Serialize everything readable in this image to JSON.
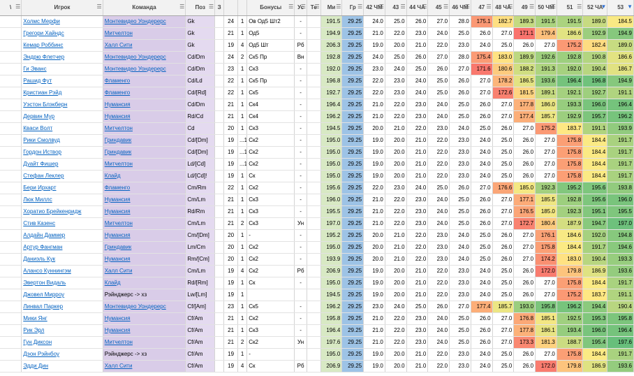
{
  "columns": [
    {
      "label": "\\",
      "filter": true
    },
    {
      "label": "Игрок",
      "filter": true
    },
    {
      "label": "Команда",
      "filter": true
    },
    {
      "label": "Поз",
      "filter": true
    },
    {
      "label": "З",
      "filter": false
    },
    {
      "label": "",
      "filter": false
    },
    {
      "label": "",
      "filter": false
    },
    {
      "label": "Бонусы",
      "filter": true
    },
    {
      "label": "Ус",
      "filter": true
    },
    {
      "label": "Те",
      "filter": true
    },
    {
      "label": "Ми",
      "filter": true
    },
    {
      "label": "Гр",
      "filter": true
    },
    {
      "label": "42 ЧМ",
      "filter": true
    },
    {
      "label": "43",
      "filter": true
    },
    {
      "label": "44 ЧА",
      "filter": true
    },
    {
      "label": "45",
      "filter": true
    },
    {
      "label": "46 ЧМ",
      "filter": true
    },
    {
      "label": "47",
      "filter": true
    },
    {
      "label": "48 ЧА",
      "filter": true
    },
    {
      "label": "49",
      "filter": true
    },
    {
      "label": "50 ЧМ",
      "filter": true
    },
    {
      "label": "51",
      "filter": true
    },
    {
      "label": "52 ЧА",
      "filter": true,
      "active": true
    },
    {
      "label": "53",
      "filter": true,
      "active": true
    }
  ],
  "rows": [
    {
      "player": "Холмс Мерфи",
      "team": "Монтевидео Уондерерс",
      "team_link": true,
      "pos": "Gk",
      "age": "24",
      "n": "1",
      "bonus": "Ов Од5 Шт2",
      "us": "-",
      "te": "",
      "mi": "191.5",
      "gr": "29.25",
      "v42": "24.0",
      "v43": "25.0",
      "v44": "26.0",
      "v45": "27.0",
      "v46": "28.0",
      "v47": "175.1",
      "v48": "182.7",
      "v49": "189.3",
      "v50": "191.5",
      "v51": "191.5",
      "v52": "189.0",
      "v53": "184.5",
      "grp": false
    },
    {
      "player": "Грегори Хайндс",
      "team": "Митчелтон",
      "team_link": true,
      "pos": "Gk",
      "age": "21",
      "n": "1",
      "bonus": "Од5",
      "us": "-",
      "te": "",
      "mi": "194.9",
      "gr": "29.25",
      "v42": "21.0",
      "v43": "22.0",
      "v44": "23.0",
      "v45": "24.0",
      "v46": "25.0",
      "v47": "26.0",
      "v48": "27.0",
      "v49": "171.1",
      "v50": "179.4",
      "v51": "186.6",
      "v52": "192.9",
      "v53": "194.9",
      "grp": false
    },
    {
      "player": "Кемар Роббинс",
      "team": "Халл Сити",
      "team_link": true,
      "pos": "Gk",
      "age": "19",
      "n": "4",
      "bonus": "Од5 Шт",
      "us": "Рб",
      "te": "",
      "mi": "206.3",
      "gr": "29.25",
      "v42": "19.0",
      "v43": "20.0",
      "v44": "21.0",
      "v45": "22.0",
      "v46": "23.0",
      "v47": "24.0",
      "v48": "25.0",
      "v49": "26.0",
      "v50": "27.0",
      "v51": "175.2",
      "v52": "182.4",
      "v53": "189.0",
      "grp": false
    },
    {
      "player": "Эндрю Флетчер",
      "team": "Монтевидео Уондерерс",
      "team_link": true,
      "pos": "Cd/Dm",
      "age": "24",
      "n": "2",
      "bonus": "Ск5 Пр",
      "us": "Вн",
      "te": "",
      "mi": "192.8",
      "gr": "29.25",
      "v42": "24.0",
      "v43": "25.0",
      "v44": "26.0",
      "v45": "27.0",
      "v46": "28.0",
      "v47": "175.4",
      "v48": "183.0",
      "v49": "189.9",
      "v50": "192.6",
      "v51": "192.8",
      "v52": "190.8",
      "v53": "186.6",
      "grp": false
    },
    {
      "player": "Ги Эванс",
      "team": "Монтевидео Уондерерс",
      "team_link": true,
      "pos": "Cd/Dm",
      "age": "23",
      "n": "1",
      "bonus": "Ск3",
      "us": "-",
      "te": "",
      "mi": "192.0",
      "gr": "29.25",
      "v42": "23.0",
      "v43": "24.0",
      "v44": "25.0",
      "v45": "26.0",
      "v46": "27.0",
      "v47": "171.6",
      "v48": "180.6",
      "v49": "188.2",
      "v50": "191.3",
      "v51": "192.0",
      "v52": "190.4",
      "v53": "186.7",
      "grp": false
    },
    {
      "player": "Рашид Фут",
      "team": "Фламенго",
      "team_link": true,
      "pos": "Cd/Ld",
      "age": "22",
      "n": "1",
      "bonus": "Ск5 Пр",
      "us": "-",
      "te": "",
      "mi": "196.8",
      "gr": "29.25",
      "v42": "22.0",
      "v43": "23.0",
      "v44": "24.0",
      "v45": "25.0",
      "v46": "26.0",
      "v47": "27.0",
      "v48": "178.2",
      "v49": "186.5",
      "v50": "193.6",
      "v51": "196.4",
      "v52": "196.8",
      "v53": "194.9",
      "grp": false
    },
    {
      "player": "Кристиан Рэйд",
      "team": "Фламенго",
      "team_link": true,
      "pos": "Cd/[Rd]",
      "age": "22",
      "n": "1",
      "bonus": "Ск5",
      "us": "-",
      "te": "",
      "mi": "192.7",
      "gr": "29.25",
      "v42": "22.0",
      "v43": "23.0",
      "v44": "24.0",
      "v45": "25.0",
      "v46": "26.0",
      "v47": "27.0",
      "v48": "172.6",
      "v49": "181.5",
      "v50": "189.1",
      "v51": "192.1",
      "v52": "192.7",
      "v53": "191.1",
      "grp": true
    },
    {
      "player": "Уэстон Блэкберн",
      "team": "Нумансия",
      "team_link": true,
      "pos": "Cd/Dm",
      "age": "21",
      "n": "1",
      "bonus": "Ск4",
      "us": "-",
      "te": "",
      "mi": "196.4",
      "gr": "29.25",
      "v42": "21.0",
      "v43": "22.0",
      "v44": "23.0",
      "v45": "24.0",
      "v46": "25.0",
      "v47": "26.0",
      "v48": "27.0",
      "v49": "177.8",
      "v50": "186.0",
      "v51": "193.3",
      "v52": "196.0",
      "v53": "196.4",
      "grp": true
    },
    {
      "player": "Дервин Мур",
      "team": "Нумансия",
      "team_link": true,
      "pos": "Rd/Cd",
      "age": "21",
      "n": "1",
      "bonus": "Ск4",
      "us": "-",
      "te": "",
      "mi": "196.2",
      "gr": "29.25",
      "v42": "21.0",
      "v43": "22.0",
      "v44": "23.0",
      "v45": "24.0",
      "v46": "25.0",
      "v47": "26.0",
      "v48": "27.0",
      "v49": "177.4",
      "v50": "185.7",
      "v51": "192.9",
      "v52": "195.7",
      "v53": "196.2",
      "grp": false
    },
    {
      "player": "Кваси Волт",
      "team": "Митчелтон",
      "team_link": true,
      "pos": "Cd",
      "age": "20",
      "n": "1",
      "bonus": "Ск3",
      "us": "-",
      "te": "",
      "mi": "194.5",
      "gr": "29.25",
      "v42": "20.0",
      "v43": "21.0",
      "v44": "22.0",
      "v45": "23.0",
      "v46": "24.0",
      "v47": "25.0",
      "v48": "26.0",
      "v49": "27.0",
      "v50": "175.2",
      "v51": "183.7",
      "v52": "191.1",
      "v53": "193.9",
      "grp": false
    },
    {
      "player": "Рики Смолвуд",
      "team": "Гриндавик",
      "team_link": true,
      "pos": "Cd/[Dm]",
      "age": "19",
      "n": "...1",
      "bonus": "Ск2",
      "us": "-",
      "te": "",
      "mi": "195.0",
      "gr": "29.25",
      "v42": "19.0",
      "v43": "20.0",
      "v44": "21.0",
      "v45": "22.0",
      "v46": "23.0",
      "v47": "24.0",
      "v48": "25.0",
      "v49": "26.0",
      "v50": "27.0",
      "v51": "175.8",
      "v52": "184.4",
      "v53": "191.7",
      "grp": false
    },
    {
      "player": "Гордон Иствор",
      "team": "Гриндавик",
      "team_link": true,
      "pos": "Cd/[Dm]",
      "age": "19",
      "n": "...1",
      "bonus": "Ск2",
      "us": "-",
      "te": "",
      "mi": "195.0",
      "gr": "29.25",
      "v42": "19.0",
      "v43": "20.0",
      "v44": "21.0",
      "v45": "22.0",
      "v46": "23.0",
      "v47": "24.0",
      "v48": "25.0",
      "v49": "26.0",
      "v50": "27.0",
      "v51": "175.8",
      "v52": "184.4",
      "v53": "191.7",
      "grp": false
    },
    {
      "player": "Дуайт Фишер",
      "team": "Митчелтон",
      "team_link": true,
      "pos": "Ld/[Cd]",
      "age": "19",
      "n": "...1",
      "bonus": "Ск2",
      "us": "-",
      "te": "",
      "mi": "195.0",
      "gr": "29.25",
      "v42": "19.0",
      "v43": "20.0",
      "v44": "21.0",
      "v45": "22.0",
      "v46": "23.0",
      "v47": "24.0",
      "v48": "25.0",
      "v49": "26.0",
      "v50": "27.0",
      "v51": "175.8",
      "v52": "184.4",
      "v53": "191.7",
      "grp": false
    },
    {
      "player": "Стефан Леклер",
      "team": "Клайд",
      "team_link": true,
      "pos": "Ld/[Cd]!",
      "age": "19",
      "n": "1",
      "bonus": "Ск",
      "us": "-",
      "te": "",
      "mi": "195.0",
      "gr": "29.25",
      "v42": "19.0",
      "v43": "20.0",
      "v44": "21.0",
      "v45": "22.0",
      "v46": "23.0",
      "v47": "24.0",
      "v48": "25.0",
      "v49": "26.0",
      "v50": "27.0",
      "v51": "175.8",
      "v52": "184.4",
      "v53": "191.7",
      "grp": false
    },
    {
      "player": "Бери Ирхарт",
      "team": "Фламенго",
      "team_link": true,
      "pos": "Cm/Rm",
      "age": "22",
      "n": "1",
      "bonus": "Ск2",
      "us": "-",
      "te": "",
      "mi": "195.6",
      "gr": "29.25",
      "v42": "22.0",
      "v43": "23.0",
      "v44": "24.0",
      "v45": "25.0",
      "v46": "26.0",
      "v47": "27.0",
      "v48": "176.6",
      "v49": "185.0",
      "v50": "192.3",
      "v51": "195.2",
      "v52": "195.6",
      "v53": "193.8",
      "grp": true
    },
    {
      "player": "Люк Миллс",
      "team": "Нумансия",
      "team_link": true,
      "pos": "Cm/Lm",
      "age": "21",
      "n": "1",
      "bonus": "Ск3",
      "us": "-",
      "te": "",
      "mi": "196.0",
      "gr": "29.25",
      "v42": "21.0",
      "v43": "22.0",
      "v44": "23.0",
      "v45": "24.0",
      "v46": "25.0",
      "v47": "26.0",
      "v48": "27.0",
      "v49": "177.1",
      "v50": "185.5",
      "v51": "192.8",
      "v52": "195.6",
      "v53": "196.0",
      "grp": false
    },
    {
      "player": "Хоратио Брейкенридж",
      "team": "Нумансия",
      "team_link": true,
      "pos": "Rd/Rm",
      "age": "21",
      "n": "1",
      "bonus": "Ск3",
      "us": "-",
      "te": "",
      "mi": "195.5",
      "gr": "29.25",
      "v42": "21.0",
      "v43": "22.0",
      "v44": "23.0",
      "v45": "24.0",
      "v46": "25.0",
      "v47": "26.0",
      "v48": "27.0",
      "v49": "176.5",
      "v50": "185.0",
      "v51": "192.3",
      "v52": "195.1",
      "v53": "195.5",
      "grp": true
    },
    {
      "player": "Стив Казенс",
      "team": "Митчелтон",
      "team_link": true,
      "pos": "Cm/Lm",
      "age": "21",
      "n": "2",
      "bonus": "Ск3",
      "us": "Ун",
      "te": "",
      "mi": "197.0",
      "gr": "29.25",
      "v42": "21.0",
      "v43": "22.0",
      "v44": "23.0",
      "v45": "24.0",
      "v46": "25.0",
      "v47": "26.0",
      "v48": "27.0",
      "v49": "172.7",
      "v50": "180.4",
      "v51": "187.9",
      "v52": "194.7",
      "v53": "197.0",
      "grp": false
    },
    {
      "player": "Алдайн Даммер",
      "team": "Нумансия",
      "team_link": true,
      "pos": "Cm/[Dm]",
      "age": "20",
      "n": "1",
      "bonus": "-",
      "us": "-",
      "te": "",
      "mi": "195.2",
      "gr": "29.25",
      "v42": "20.0",
      "v43": "21.0",
      "v44": "22.0",
      "v45": "23.0",
      "v46": "24.0",
      "v47": "25.0",
      "v48": "26.0",
      "v49": "27.0",
      "v50": "176.1",
      "v51": "184.6",
      "v52": "192.0",
      "v53": "194.8",
      "grp": false
    },
    {
      "player": "Артур Фангман",
      "team": "Гриндавик",
      "team_link": true,
      "pos": "Lm/Cm",
      "age": "20",
      "n": "1",
      "bonus": "Ск2",
      "us": "-",
      "te": "",
      "mi": "195.0",
      "gr": "29.25",
      "v42": "20.0",
      "v43": "21.0",
      "v44": "22.0",
      "v45": "23.0",
      "v46": "24.0",
      "v47": "25.0",
      "v48": "26.0",
      "v49": "27.0",
      "v50": "175.8",
      "v51": "184.4",
      "v52": "191.7",
      "v53": "194.6",
      "grp": false
    },
    {
      "player": "Даниэль Кук",
      "team": "Нумансия",
      "team_link": true,
      "pos": "Rm/[Cm]",
      "age": "20",
      "n": "1",
      "bonus": "Ск2",
      "us": "-",
      "te": "",
      "mi": "193.9",
      "gr": "29.25",
      "v42": "20.0",
      "v43": "21.0",
      "v44": "22.0",
      "v45": "23.0",
      "v46": "24.0",
      "v47": "25.0",
      "v48": "26.0",
      "v49": "27.0",
      "v50": "174.2",
      "v51": "183.0",
      "v52": "190.4",
      "v53": "193.3",
      "grp": false
    },
    {
      "player": "Алансо Куннингэм",
      "team": "Халл Сити",
      "team_link": true,
      "pos": "Cm/Lm",
      "age": "19",
      "n": "4",
      "bonus": "Ск2",
      "us": "Рб",
      "te": "",
      "mi": "206.9",
      "gr": "29.25",
      "v42": "19.0",
      "v43": "20.0",
      "v44": "21.0",
      "v45": "22.0",
      "v46": "23.0",
      "v47": "24.0",
      "v48": "25.0",
      "v49": "26.0",
      "v50": "172.0",
      "v51": "179.8",
      "v52": "186.9",
      "v53": "193.6",
      "grp": false
    },
    {
      "player": "Эвертон Видаль",
      "team": "Клайд",
      "team_link": true,
      "pos": "Rd/[Rm]",
      "age": "19",
      "n": "1",
      "bonus": "Ск",
      "us": "-",
      "te": "",
      "mi": "195.0",
      "gr": "29.25",
      "v42": "19.0",
      "v43": "20.0",
      "v44": "21.0",
      "v45": "22.0",
      "v46": "23.0",
      "v47": "24.0",
      "v48": "25.0",
      "v49": "26.0",
      "v50": "27.0",
      "v51": "175.8",
      "v52": "184.4",
      "v53": "191.7",
      "grp": false
    },
    {
      "player": "Джовел Мирроу",
      "team": "Рэйнджерс -> хз",
      "team_link": false,
      "pos": "Lw/[Lm]",
      "age": "19",
      "n": "1",
      "bonus": "",
      "us": "",
      "te": "",
      "mi": "194.5",
      "gr": "29.25",
      "v42": "19.0",
      "v43": "20.0",
      "v44": "21.0",
      "v45": "22.0",
      "v46": "23.0",
      "v47": "24.0",
      "v48": "25.0",
      "v49": "26.0",
      "v50": "27.0",
      "v51": "175.2",
      "v52": "183.7",
      "v53": "191.1",
      "grp": false
    },
    {
      "player": "Линвал Паркер",
      "team": "Монтевидео Уондерерс",
      "team_link": true,
      "pos": "Cf/[Am]",
      "age": "23",
      "n": "1",
      "bonus": "Ск5",
      "us": "-",
      "te": "",
      "mi": "196.2",
      "gr": "29.25",
      "v42": "23.0",
      "v43": "24.0",
      "v44": "25.0",
      "v45": "26.0",
      "v46": "27.0",
      "v47": "177.4",
      "v48": "185.7",
      "v49": "193.0",
      "v50": "195.8",
      "v51": "196.2",
      "v52": "194.4",
      "v53": "190.4",
      "grp": true
    },
    {
      "player": "Мики Янг",
      "team": "Нумансия",
      "team_link": true,
      "pos": "Cf/Am",
      "age": "21",
      "n": "1",
      "bonus": "Ск2",
      "us": "-",
      "te": "",
      "mi": "195.8",
      "gr": "29.25",
      "v42": "21.0",
      "v43": "22.0",
      "v44": "23.0",
      "v45": "24.0",
      "v46": "25.0",
      "v47": "26.0",
      "v48": "27.0",
      "v49": "176.8",
      "v50": "185.1",
      "v51": "192.5",
      "v52": "195.3",
      "v53": "195.8",
      "grp": false
    },
    {
      "player": "Рик Эрл",
      "team": "Нумансия",
      "team_link": true,
      "pos": "Cf/Am",
      "age": "21",
      "n": "1",
      "bonus": "Ск3",
      "us": "-",
      "te": "",
      "mi": "196.4",
      "gr": "29.25",
      "v42": "21.0",
      "v43": "22.0",
      "v44": "23.0",
      "v45": "24.0",
      "v46": "25.0",
      "v47": "26.0",
      "v48": "27.0",
      "v49": "177.8",
      "v50": "186.1",
      "v51": "193.4",
      "v52": "196.0",
      "v53": "196.4",
      "grp": false
    },
    {
      "player": "Гун Диксон",
      "team": "Митчелтон",
      "team_link": true,
      "pos": "Cf/Am",
      "age": "21",
      "n": "2",
      "bonus": "Ск2",
      "us": "Ун",
      "te": "",
      "mi": "197.6",
      "gr": "29.25",
      "v42": "21.0",
      "v43": "22.0",
      "v44": "23.0",
      "v45": "24.0",
      "v46": "25.0",
      "v47": "26.0",
      "v48": "27.0",
      "v49": "173.3",
      "v50": "181.3",
      "v51": "188.7",
      "v52": "195.4",
      "v53": "197.6",
      "grp": false
    },
    {
      "player": "Дэон Рэйнбоу",
      "team": "Рэйнджерс -> хз",
      "team_link": false,
      "pos": "Cf/Am",
      "age": "19",
      "n": "1",
      "bonus": "-",
      "us": "",
      "te": "",
      "mi": "195.0",
      "gr": "29.25",
      "v42": "19.0",
      "v43": "20.0",
      "v44": "21.0",
      "v45": "22.0",
      "v46": "23.0",
      "v47": "24.0",
      "v48": "25.0",
      "v49": "26.0",
      "v50": "27.0",
      "v51": "175.8",
      "v52": "184.4",
      "v53": "191.7",
      "grp": false
    },
    {
      "player": "Эдди Дин",
      "team": "Халл Сити",
      "team_link": true,
      "pos": "Cf/Am",
      "age": "19",
      "n": "4",
      "bonus": "Ск",
      "us": "Рб",
      "te": "",
      "mi": "206.9",
      "gr": "29.25",
      "v42": "19.0",
      "v43": "20.0",
      "v44": "21.0",
      "v45": "22.0",
      "v46": "23.0",
      "v47": "24.0",
      "v48": "25.0",
      "v49": "26.0",
      "v50": "172.0",
      "v51": "179.8",
      "v52": "186.9",
      "v53": "193.6",
      "grp": false
    }
  ],
  "colors": {
    "hdr_bg": "#f2f2f2",
    "team_bg": "#d9cce8",
    "gr_bg": "#9dc3e6",
    "mi_bg": "#d8e9c4",
    "scale_low": "#f8696b",
    "scale_mid": "#ffeb84",
    "scale_high": "#63be7b",
    "link": "#0563c1"
  }
}
